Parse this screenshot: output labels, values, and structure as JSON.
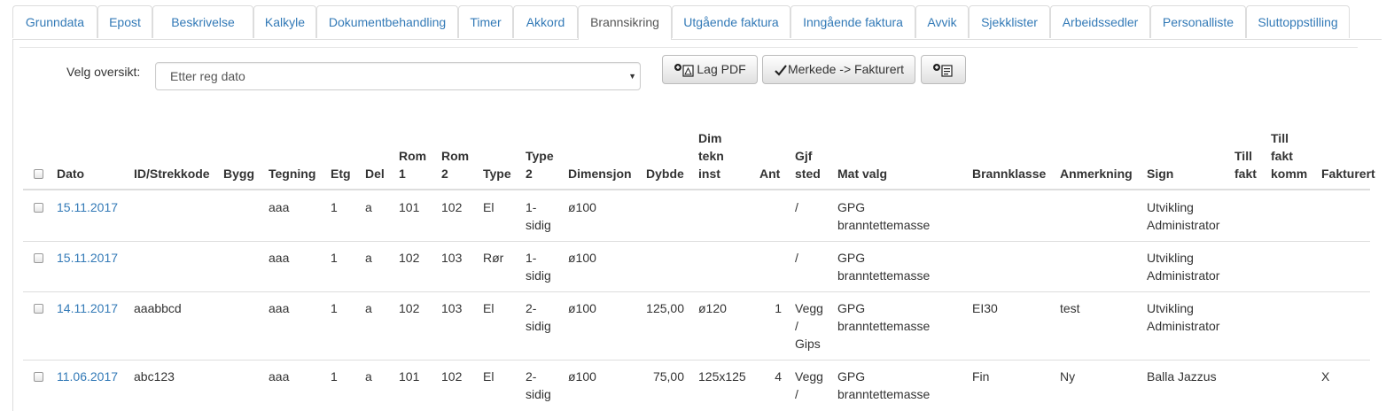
{
  "tabs": [
    {
      "label": "Grunndata"
    },
    {
      "label": "Epost"
    },
    {
      "label": "Beskrivelse"
    },
    {
      "label": "Kalkyle"
    },
    {
      "label": "Dokumentbehandling"
    },
    {
      "label": "Timer"
    },
    {
      "label": "Akkord"
    },
    {
      "label": "Brannsikring",
      "active": true
    },
    {
      "label": "Utgående faktura"
    },
    {
      "label": "Inngående faktura"
    },
    {
      "label": "Avvik"
    },
    {
      "label": "Sjekklister"
    },
    {
      "label": "Arbeidssedler"
    },
    {
      "label": "Personalliste"
    },
    {
      "label": "Sluttoppstilling"
    }
  ],
  "toolbar": {
    "overview_label": "Velg oversikt:",
    "overview_value": "Etter reg dato",
    "pdf_label": "Lag PDF",
    "mark_label": "Merkede -> Fakturert"
  },
  "table": {
    "headers": {
      "dato": "Dato",
      "id": "ID/Strekkode",
      "bygg": "Bygg",
      "tegning": "Tegning",
      "etg": "Etg",
      "del": "Del",
      "rom1_a": "Rom",
      "rom1_b": "1",
      "rom2_a": "Rom",
      "rom2_b": "2",
      "type": "Type",
      "type2_a": "Type",
      "type2_b": "2",
      "dimensjon": "Dimensjon",
      "dybde": "Dybde",
      "dim_a": "Dim",
      "dim_b": "tekn",
      "dim_c": "inst",
      "ant": "Ant",
      "gjf_a": "Gjf",
      "gjf_b": "sted",
      "mat": "Mat valg",
      "brannklasse": "Brannklasse",
      "anmerkning": "Anmerkning",
      "sign": "Sign",
      "till_a": "Till",
      "till_b": "fakt",
      "tillk_a": "Till",
      "tillk_b": "fakt",
      "tillk_c": "komm",
      "fakturert": "Fakturert"
    },
    "rows": [
      {
        "dato": "15.11.2017",
        "id": "",
        "tegning": "aaa",
        "etg": "1",
        "del": "a",
        "rom1": "101",
        "rom2": "102",
        "type": "El",
        "type2_a": "1-",
        "type2_b": "sidig",
        "dimensjon": "ø100",
        "dybde": "",
        "dim": "",
        "ant": "",
        "gjf_a": "/",
        "gjf_b": "",
        "gjf_c": "",
        "mat_a": "GPG",
        "mat_b": "branntettemasse",
        "brannklasse": "",
        "anmerkning": "",
        "sign_a": "Utvikling",
        "sign_b": "Administrator",
        "fakturert": ""
      },
      {
        "dato": "15.11.2017",
        "id": "",
        "tegning": "aaa",
        "etg": "1",
        "del": "a",
        "rom1": "102",
        "rom2": "103",
        "type": "Rør",
        "type2_a": "1-",
        "type2_b": "sidig",
        "dimensjon": "ø100",
        "dybde": "",
        "dim": "",
        "ant": "",
        "gjf_a": "/",
        "gjf_b": "",
        "gjf_c": "",
        "mat_a": "GPG",
        "mat_b": "branntettemasse",
        "brannklasse": "",
        "anmerkning": "",
        "sign_a": "Utvikling",
        "sign_b": "Administrator",
        "fakturert": ""
      },
      {
        "dato": "14.11.2017",
        "id": "aaabbcd",
        "tegning": "aaa",
        "etg": "1",
        "del": "a",
        "rom1": "102",
        "rom2": "103",
        "type": "El",
        "type2_a": "2-",
        "type2_b": "sidig",
        "dimensjon": "ø100",
        "dybde": "125,00",
        "dim": "ø120",
        "ant": "1",
        "gjf_a": "Vegg",
        "gjf_b": "/",
        "gjf_c": "Gips",
        "mat_a": "GPG",
        "mat_b": "branntettemasse",
        "brannklasse": "EI30",
        "anmerkning": "test",
        "sign_a": "Utvikling",
        "sign_b": "Administrator",
        "fakturert": ""
      },
      {
        "dato": "11.06.2017",
        "id": "abc123",
        "tegning": "aaa",
        "etg": "1",
        "del": "a",
        "rom1": "101",
        "rom2": "102",
        "type": "El",
        "type2_a": "2-",
        "type2_b": "sidig",
        "dimensjon": "ø100",
        "dybde": "75,00",
        "dim": "125x125",
        "ant": "4",
        "gjf_a": "Vegg",
        "gjf_b": "/",
        "gjf_c": "",
        "mat_a": "GPG",
        "mat_b": "branntettemasse",
        "brannklasse": "Fin",
        "anmerkning": "Ny",
        "sign_a": "Balla Jazzus",
        "sign_b": "",
        "fakturert": "X"
      }
    ]
  },
  "colors": {
    "link": "#337ab7",
    "border": "#dddddd"
  },
  "icons": {
    "pdf": "add-pdf-icon",
    "check": "check-icon",
    "add_doc": "add-document-icon"
  }
}
